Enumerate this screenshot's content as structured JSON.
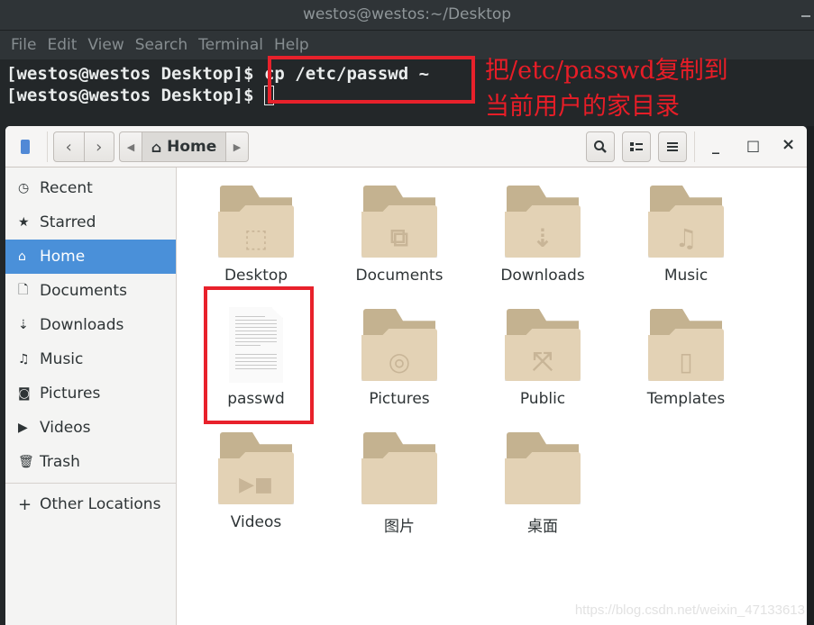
{
  "terminal": {
    "title": "westos@westos:~/Desktop",
    "menu": [
      "File",
      "Edit",
      "View",
      "Search",
      "Terminal",
      "Help"
    ],
    "lines": [
      {
        "prompt": "[westos@westos Desktop]$ ",
        "command": "cp /etc/passwd ~"
      },
      {
        "prompt": "[westos@westos Desktop]$ ",
        "command": ""
      }
    ]
  },
  "annotation": {
    "line1": "把/etc/passwd复制到",
    "line2": "当前用户的家目录",
    "color": "#e8212b"
  },
  "file_manager": {
    "header": {
      "path_current": "Home",
      "back_icon": "chevron-left-icon",
      "forward_icon": "chevron-right-icon",
      "search_icon": "search-icon",
      "view_icon": "list-view-icon",
      "menu_icon": "hamburger-menu-icon",
      "minimize": "_",
      "maximize": "□",
      "close": "×"
    },
    "sidebar": {
      "items": [
        {
          "label": "Recent",
          "icon": "clock-icon",
          "glyph": "◷",
          "active": false
        },
        {
          "label": "Starred",
          "icon": "star-icon",
          "glyph": "★",
          "active": false
        },
        {
          "label": "Home",
          "icon": "home-icon",
          "glyph": "⌂",
          "active": true
        },
        {
          "label": "Documents",
          "icon": "document-icon",
          "glyph": "🗋",
          "active": false
        },
        {
          "label": "Downloads",
          "icon": "download-icon",
          "glyph": "⇣",
          "active": false
        },
        {
          "label": "Music",
          "icon": "music-icon",
          "glyph": "♫",
          "active": false
        },
        {
          "label": "Pictures",
          "icon": "camera-icon",
          "glyph": "◙",
          "active": false
        },
        {
          "label": "Videos",
          "icon": "video-icon",
          "glyph": "▶",
          "active": false
        },
        {
          "label": "Trash",
          "icon": "trash-icon",
          "glyph": "🗑",
          "active": false
        }
      ],
      "other_locations": {
        "label": "Other Locations",
        "glyph": "+"
      }
    },
    "files": [
      {
        "name": "Desktop",
        "type": "folder",
        "emblem": "⬚"
      },
      {
        "name": "Documents",
        "type": "folder",
        "emblem": "⧉"
      },
      {
        "name": "Downloads",
        "type": "folder",
        "emblem": "⇣"
      },
      {
        "name": "Music",
        "type": "folder",
        "emblem": "♫"
      },
      {
        "name": "passwd",
        "type": "text-file",
        "emblem": ""
      },
      {
        "name": "Pictures",
        "type": "folder",
        "emblem": "◎"
      },
      {
        "name": "Public",
        "type": "folder",
        "emblem": "⤧"
      },
      {
        "name": "Templates",
        "type": "folder",
        "emblem": "▯"
      },
      {
        "name": "Videos",
        "type": "folder",
        "emblem": "▶■"
      },
      {
        "name": "图片",
        "type": "folder",
        "emblem": ""
      },
      {
        "name": "桌面",
        "type": "folder",
        "emblem": ""
      }
    ]
  },
  "watermark": "https://blog.csdn.net/weixin_47133613"
}
